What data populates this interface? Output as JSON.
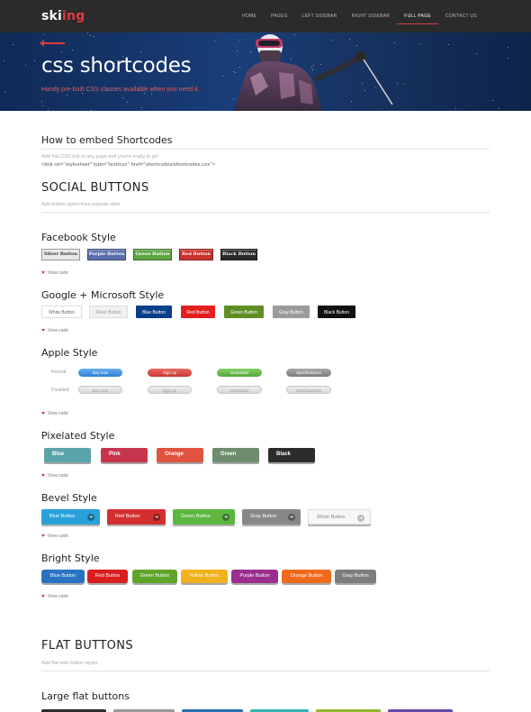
{
  "brand": {
    "prefix": "ski",
    "accent": "ing",
    "accent_color": "#e0393e"
  },
  "nav": [
    {
      "label": "HOME",
      "active": false
    },
    {
      "label": "PAGES",
      "active": false
    },
    {
      "label": "LEFT SIDEBAR",
      "active": false
    },
    {
      "label": "RIGHT SIDEBAR",
      "active": false
    },
    {
      "label": "FULL PAGE",
      "active": true
    },
    {
      "label": "CONTACT US",
      "active": false
    }
  ],
  "hero": {
    "title": "css shortcodes",
    "subtitle": "Handy pre-built CSS classes available when you need it."
  },
  "embed": {
    "title": "How to embed Shortcodes",
    "text": "Add this CSS link to any page and you're ready to go!",
    "code": "<link rel=\"stylesheet\" type=\"text/css\" href=\"shortcodes/shortcodes.css\">"
  },
  "social": {
    "title": "SOCIAL BUTTONS",
    "subtitle": "Add button styles from popular sites"
  },
  "view_code": "View code",
  "facebook": {
    "title": "Facebook Style",
    "buttons": [
      {
        "label": "Silver Button",
        "color": "#e8e8e8"
      },
      {
        "label": "Purple Button",
        "color": "#5a6fae"
      },
      {
        "label": "Green Button",
        "color": "#5ea544"
      },
      {
        "label": "Red Button",
        "color": "#c8322e"
      },
      {
        "label": "Black Button",
        "color": "#2a2a2a"
      }
    ]
  },
  "google": {
    "title": "Google + Microsoft Style",
    "buttons": [
      {
        "label": "White Button",
        "color": "#ffffff"
      },
      {
        "label": "Silver Button",
        "color": "#f1f1f1"
      },
      {
        "label": "Blue Button",
        "color": "#0a3f8a"
      },
      {
        "label": "Red Button",
        "color": "#e21f1f"
      },
      {
        "label": "Green Button",
        "color": "#5f8f24"
      },
      {
        "label": "Gray Button",
        "color": "#9b9b9b"
      },
      {
        "label": "Black Button",
        "color": "#111111"
      }
    ]
  },
  "apple": {
    "title": "Apple Style",
    "normal_label": "Normal:",
    "disabled_label": "Disabled:",
    "buttons": [
      {
        "label": "Buy now",
        "color": "#3c8ee2"
      },
      {
        "label": "Sign up",
        "color": "#d9473f"
      },
      {
        "label": "Download",
        "color": "#62b845"
      },
      {
        "label": "Specifications",
        "color": "#8c8c8c"
      }
    ]
  },
  "pixelated": {
    "title": "Pixelated Style",
    "buttons": [
      {
        "label": "Blue",
        "color": "#5ba3ab"
      },
      {
        "label": "Pink",
        "color": "#c7354d"
      },
      {
        "label": "Orange",
        "color": "#e0533e"
      },
      {
        "label": "Green",
        "color": "#6e8c6e"
      },
      {
        "label": "Black",
        "color": "#2c2c2c"
      }
    ]
  },
  "bevel": {
    "title": "Bevel Style",
    "buttons": [
      {
        "label": "Blue Button",
        "color": "#2aa0db"
      },
      {
        "label": "Red Button",
        "color": "#d32f2f"
      },
      {
        "label": "Green Button",
        "color": "#5cb63f"
      },
      {
        "label": "Gray Button",
        "color": "#888888"
      },
      {
        "label": "White Button",
        "color": "#f7f7f7"
      }
    ]
  },
  "bright": {
    "title": "Bright Style",
    "buttons": [
      {
        "label": "Blue Button",
        "color": "#2a72c3"
      },
      {
        "label": "Red Button",
        "color": "#d81e1e"
      },
      {
        "label": "Green Button",
        "color": "#5fa52b"
      },
      {
        "label": "Yellow Button",
        "color": "#f0b21d"
      },
      {
        "label": "Purple Button",
        "color": "#9b2d8e"
      },
      {
        "label": "Orange Button",
        "color": "#f06a1c"
      },
      {
        "label": "Gray Button",
        "color": "#7d7d7d"
      }
    ]
  },
  "flat": {
    "title": "FLAT BUTTONS",
    "subtitle": "Add flat web button styles"
  },
  "large_flat": {
    "title": "Large flat buttons",
    "colors": [
      "#2b2b2b",
      "#9a9a9a",
      "#2a6fb0",
      "#38b3b6",
      "#8fb92e",
      "#6a4aa8"
    ]
  }
}
